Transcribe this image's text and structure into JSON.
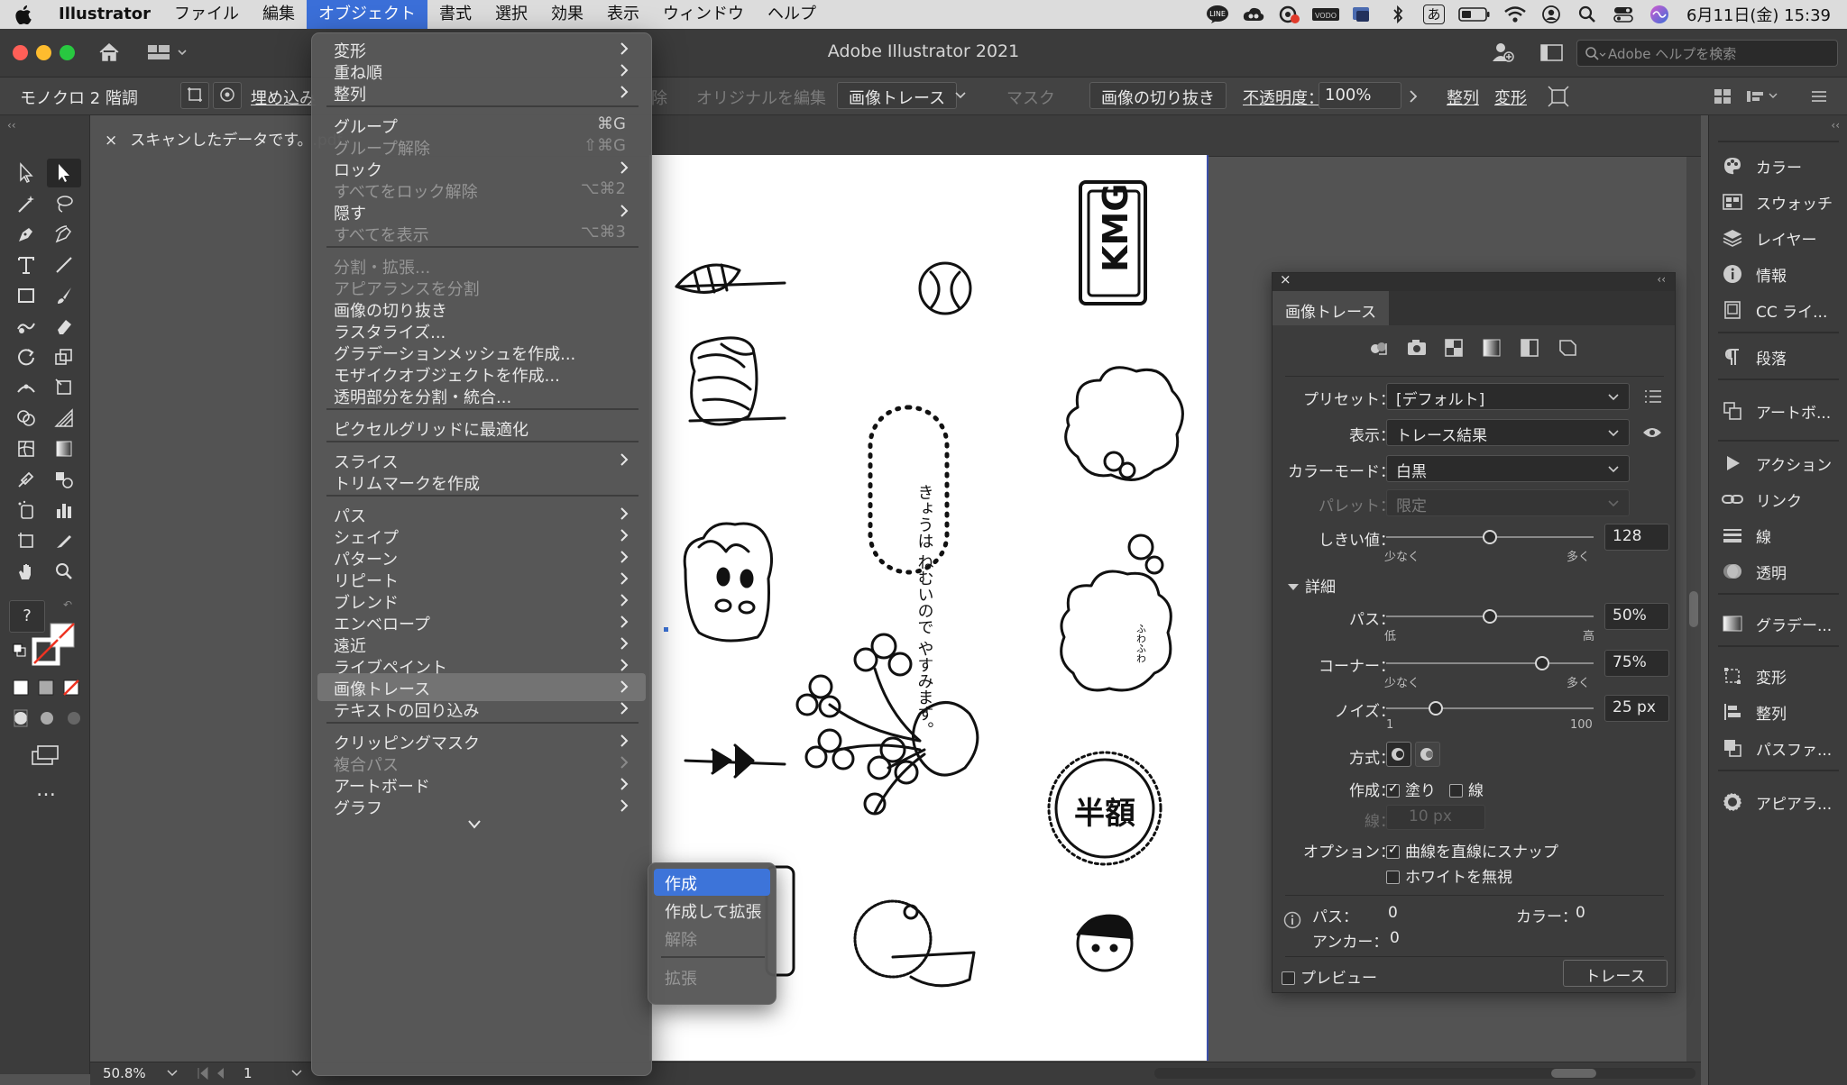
{
  "colors": {
    "menubar_bg": "#dcdcdc",
    "accent_blue": "#3d74d9",
    "panel_bg": "#3c3c3c",
    "canvas_bg": "#535353",
    "artboard": "#ffffff"
  },
  "menubar": {
    "app_name": "Illustrator",
    "items": [
      "ファイル",
      "編集",
      "オブジェクト",
      "書式",
      "選択",
      "効果",
      "表示",
      "ウィンドウ",
      "ヘルプ"
    ],
    "active_index": 2,
    "clock": "6月11日(金)  15:39",
    "status_icons": [
      "line-icon",
      "creative-cloud-icon",
      "screen-record-icon",
      "vodo-icon",
      "vpn-icon",
      "bluetooth-icon",
      "input-method-icon",
      "battery-icon",
      "wifi-icon",
      "user-icon",
      "spotlight-icon",
      "control-center-icon",
      "siri-icon"
    ],
    "input_method_label": "あ",
    "vodo_label": "VODO"
  },
  "titlebar": {
    "title": "Adobe Illustrator 2021",
    "help_placeholder": "Adobe ヘルプを検索"
  },
  "controlbar": {
    "mode_label": "モノクロ 2 階調",
    "embed_button": "埋め込み",
    "embed_partial_label": "除",
    "edit_original": "オリジナルを編集",
    "image_trace": "画像トレース",
    "mask": "マスク",
    "crop_image": "画像の切り抜き",
    "opacity_label": "不透明度：",
    "opacity_value": "100%",
    "align": "整列",
    "transform": "変形"
  },
  "document_tab": {
    "close": "×",
    "title": "スキャンしたデータです。.pdf"
  },
  "object_menu": {
    "items": [
      {
        "label": "変形",
        "submenu": true,
        "enabled": true
      },
      {
        "label": "重ね順",
        "submenu": true,
        "enabled": true
      },
      {
        "label": "整列",
        "submenu": true,
        "enabled": true
      },
      {
        "separator": true
      },
      {
        "label": "グループ",
        "shortcut": "⌘G",
        "enabled": true
      },
      {
        "label": "グループ解除",
        "shortcut": "⇧⌘G",
        "enabled": false
      },
      {
        "label": "ロック",
        "submenu": true,
        "enabled": true
      },
      {
        "label": "すべてをロック解除",
        "shortcut": "⌥⌘2",
        "enabled": false
      },
      {
        "label": "隠す",
        "submenu": true,
        "enabled": true
      },
      {
        "label": "すべてを表示",
        "shortcut": "⌥⌘3",
        "enabled": false
      },
      {
        "separator": true
      },
      {
        "label": "分割・拡張...",
        "enabled": false
      },
      {
        "label": "アピアランスを分割",
        "enabled": false
      },
      {
        "label": "画像の切り抜き",
        "enabled": true
      },
      {
        "label": "ラスタライズ...",
        "enabled": true
      },
      {
        "label": "グラデーションメッシュを作成...",
        "enabled": true
      },
      {
        "label": "モザイクオブジェクトを作成...",
        "enabled": true
      },
      {
        "label": "透明部分を分割・統合...",
        "enabled": true
      },
      {
        "separator": true
      },
      {
        "label": "ピクセルグリッドに最適化",
        "enabled": true
      },
      {
        "separator": true
      },
      {
        "label": "スライス",
        "submenu": true,
        "enabled": true
      },
      {
        "label": "トリムマークを作成",
        "enabled": true
      },
      {
        "separator": true
      },
      {
        "label": "パス",
        "submenu": true,
        "enabled": true
      },
      {
        "label": "シェイプ",
        "submenu": true,
        "enabled": true
      },
      {
        "label": "パターン",
        "submenu": true,
        "enabled": true
      },
      {
        "label": "リピート",
        "submenu": true,
        "enabled": true
      },
      {
        "label": "ブレンド",
        "submenu": true,
        "enabled": true
      },
      {
        "label": "エンベロープ",
        "submenu": true,
        "enabled": true
      },
      {
        "label": "遠近",
        "submenu": true,
        "enabled": true
      },
      {
        "label": "ライブペイント",
        "submenu": true,
        "enabled": true
      },
      {
        "label": "画像トレース",
        "submenu": true,
        "enabled": true,
        "highlighted": true
      },
      {
        "label": "テキストの回り込み",
        "submenu": true,
        "enabled": true
      },
      {
        "separator": true
      },
      {
        "label": "クリッピングマスク",
        "submenu": true,
        "enabled": true
      },
      {
        "label": "複合パス",
        "submenu": true,
        "enabled": false
      },
      {
        "label": "アートボード",
        "submenu": true,
        "enabled": true
      },
      {
        "label": "グラフ",
        "submenu": true,
        "enabled": true
      }
    ]
  },
  "trace_submenu": {
    "items": [
      {
        "label": "作成",
        "enabled": true,
        "selected": true
      },
      {
        "label": "作成して拡張",
        "enabled": true
      },
      {
        "label": "解除",
        "enabled": false
      },
      {
        "separator": true
      },
      {
        "label": "拡張",
        "enabled": false
      }
    ]
  },
  "trace_panel": {
    "close": "×",
    "collapse": "‹‹",
    "tab_title": "画像トレース",
    "preset_label": "プリセット：",
    "preset_value": "[デフォルト]",
    "view_label": "表示：",
    "view_value": "トレース結果",
    "mode_label": "カラーモード：",
    "mode_value": "白黒",
    "palette_label": "パレット：",
    "palette_value": "限定",
    "threshold_label": "しきい値：",
    "threshold_value": "128",
    "threshold_fraction": 0.5,
    "less_label": "少なく",
    "more_label": "多く",
    "advanced_label": "詳細",
    "paths_label": "パス：",
    "paths_value": "50%",
    "paths_fraction": 0.5,
    "low_label": "低",
    "high_label": "高",
    "corners_label": "コーナー：",
    "corners_value": "75%",
    "corners_fraction": 0.75,
    "noise_label": "ノイズ：",
    "noise_value": "25 px",
    "noise_fraction": 0.24,
    "noise_min": "1",
    "noise_max": "100",
    "method_label": "方式：",
    "create_label": "作成：",
    "fill_label": "塗り",
    "stroke_label": "線",
    "fill_checked": true,
    "stroke_checked": false,
    "stroke_width_label": "線：",
    "stroke_width_value": "10 px",
    "options_label": "オプション：",
    "snap_label": "曲線を直線にスナップ",
    "snap_checked": true,
    "ignore_white_label": "ホワイトを無視",
    "ignore_white_checked": false,
    "info_paths_label": "パス：",
    "info_paths_value": "0",
    "info_colors_label": "カラー：",
    "info_colors_value": "0",
    "info_anchors_label": "アンカー：",
    "info_anchors_value": "0",
    "preview_label": "プレビュー",
    "preview_checked": false,
    "trace_button": "トレース"
  },
  "dock": {
    "groups": [
      [
        {
          "label": "カラー",
          "icon": "color-icon"
        },
        {
          "label": "スウォッチ",
          "icon": "swatches-icon"
        },
        {
          "label": "レイヤー",
          "icon": "layers-icon"
        },
        {
          "label": "情報",
          "icon": "info-icon"
        },
        {
          "label": "CC ライ...",
          "icon": "cc-libraries-icon"
        }
      ],
      [
        {
          "label": "段落",
          "icon": "paragraph-icon"
        }
      ],
      [
        {
          "label": "アートボ...",
          "icon": "artboards-icon"
        }
      ],
      [
        {
          "label": "アクション",
          "icon": "actions-icon"
        },
        {
          "label": "リンク",
          "icon": "links-icon"
        },
        {
          "label": "線",
          "icon": "stroke-icon"
        },
        {
          "label": "透明",
          "icon": "transparency-icon"
        }
      ],
      [
        {
          "label": "グラデー...",
          "icon": "gradient-icon"
        }
      ],
      [
        {
          "label": "変形",
          "icon": "transform-icon"
        },
        {
          "label": "整列",
          "icon": "align-icon"
        },
        {
          "label": "パスファ...",
          "icon": "pathfinder-icon"
        }
      ],
      [
        {
          "label": "アピアラ...",
          "icon": "appearance-icon"
        }
      ]
    ]
  },
  "statusbar": {
    "zoom": "50.8%",
    "artboard_number": "1"
  },
  "artwork": {
    "logo_text": "KMG",
    "stamp_text": "半額",
    "speech_text": "きょうは ねむいので やすみます。",
    "cloud_text": "ふわふわ"
  }
}
